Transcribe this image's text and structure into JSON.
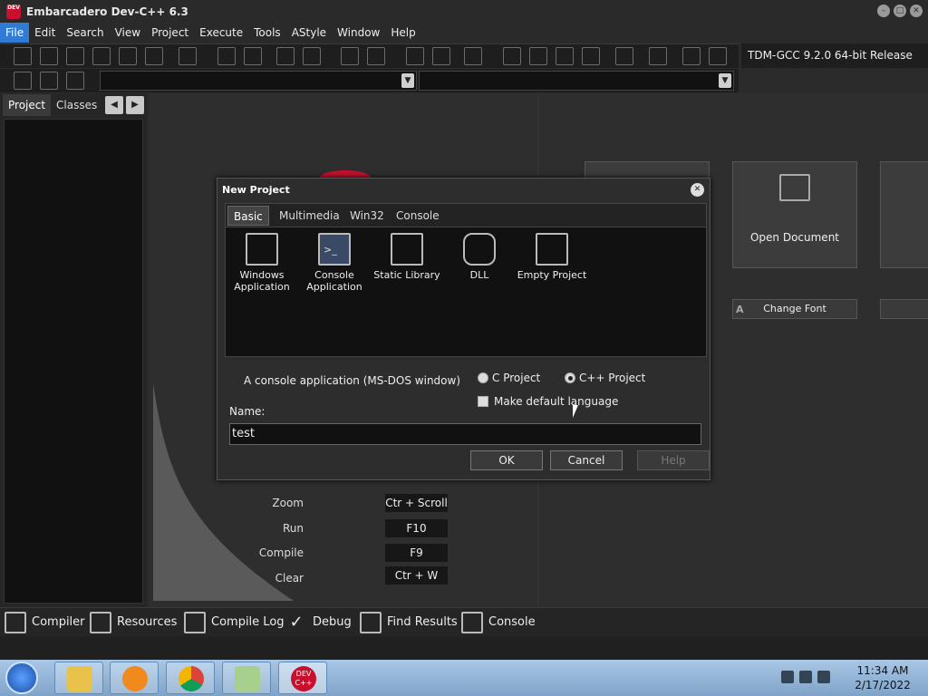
{
  "window": {
    "title": "Embarcadero Dev-C++ 6.3",
    "icon_text": "DEV"
  },
  "menu": [
    "File",
    "Edit",
    "Search",
    "View",
    "Project",
    "Execute",
    "Tools",
    "AStyle",
    "Window",
    "Help"
  ],
  "compiler_label": "TDM-GCC 9.2.0 64-bit Release",
  "left_panel": {
    "tabs": [
      "Project",
      "Classes"
    ]
  },
  "welcome": {
    "cards": [
      "Open Document"
    ],
    "buttons": [
      "Change Font"
    ],
    "shortcuts": [
      {
        "label": "Zoom",
        "key": "Ctr + Scroll"
      },
      {
        "label": "Run",
        "key": "F10"
      },
      {
        "label": "Compile",
        "key": "F9"
      },
      {
        "label": "Clear",
        "key": "Ctr + W"
      }
    ]
  },
  "dialog": {
    "title": "New Project",
    "tabs": [
      "Basic",
      "Multimedia",
      "Win32",
      "Console"
    ],
    "templates": [
      {
        "label": "Windows Application",
        "icon": "windows-app-icon"
      },
      {
        "label": "Console Application",
        "icon": "console-app-icon"
      },
      {
        "label": "Static Library",
        "icon": "static-library-icon"
      },
      {
        "label": "DLL",
        "icon": "puzzle-icon"
      },
      {
        "label": "Empty Project",
        "icon": "empty-project-icon"
      }
    ],
    "description": "A console application (MS-DOS window)",
    "radio_c": "C Project",
    "radio_cpp": "C++ Project",
    "selected_language": "C++ Project",
    "default_language_label": "Make default language",
    "name_label": "Name:",
    "name_value": "test",
    "ok_label": "OK",
    "cancel_label": "Cancel",
    "help_label": "Help"
  },
  "status_tabs": [
    "Compiler",
    "Resources",
    "Compile Log",
    "Debug",
    "Find Results",
    "Console"
  ],
  "taskbar": {
    "time": "11:34 AM",
    "date": "2/17/2022",
    "dev_label": "DEV C++"
  },
  "colors": {
    "accent": "#2f7bd6",
    "background": "#2e2e2e",
    "dialog": "#2d2d2d"
  }
}
